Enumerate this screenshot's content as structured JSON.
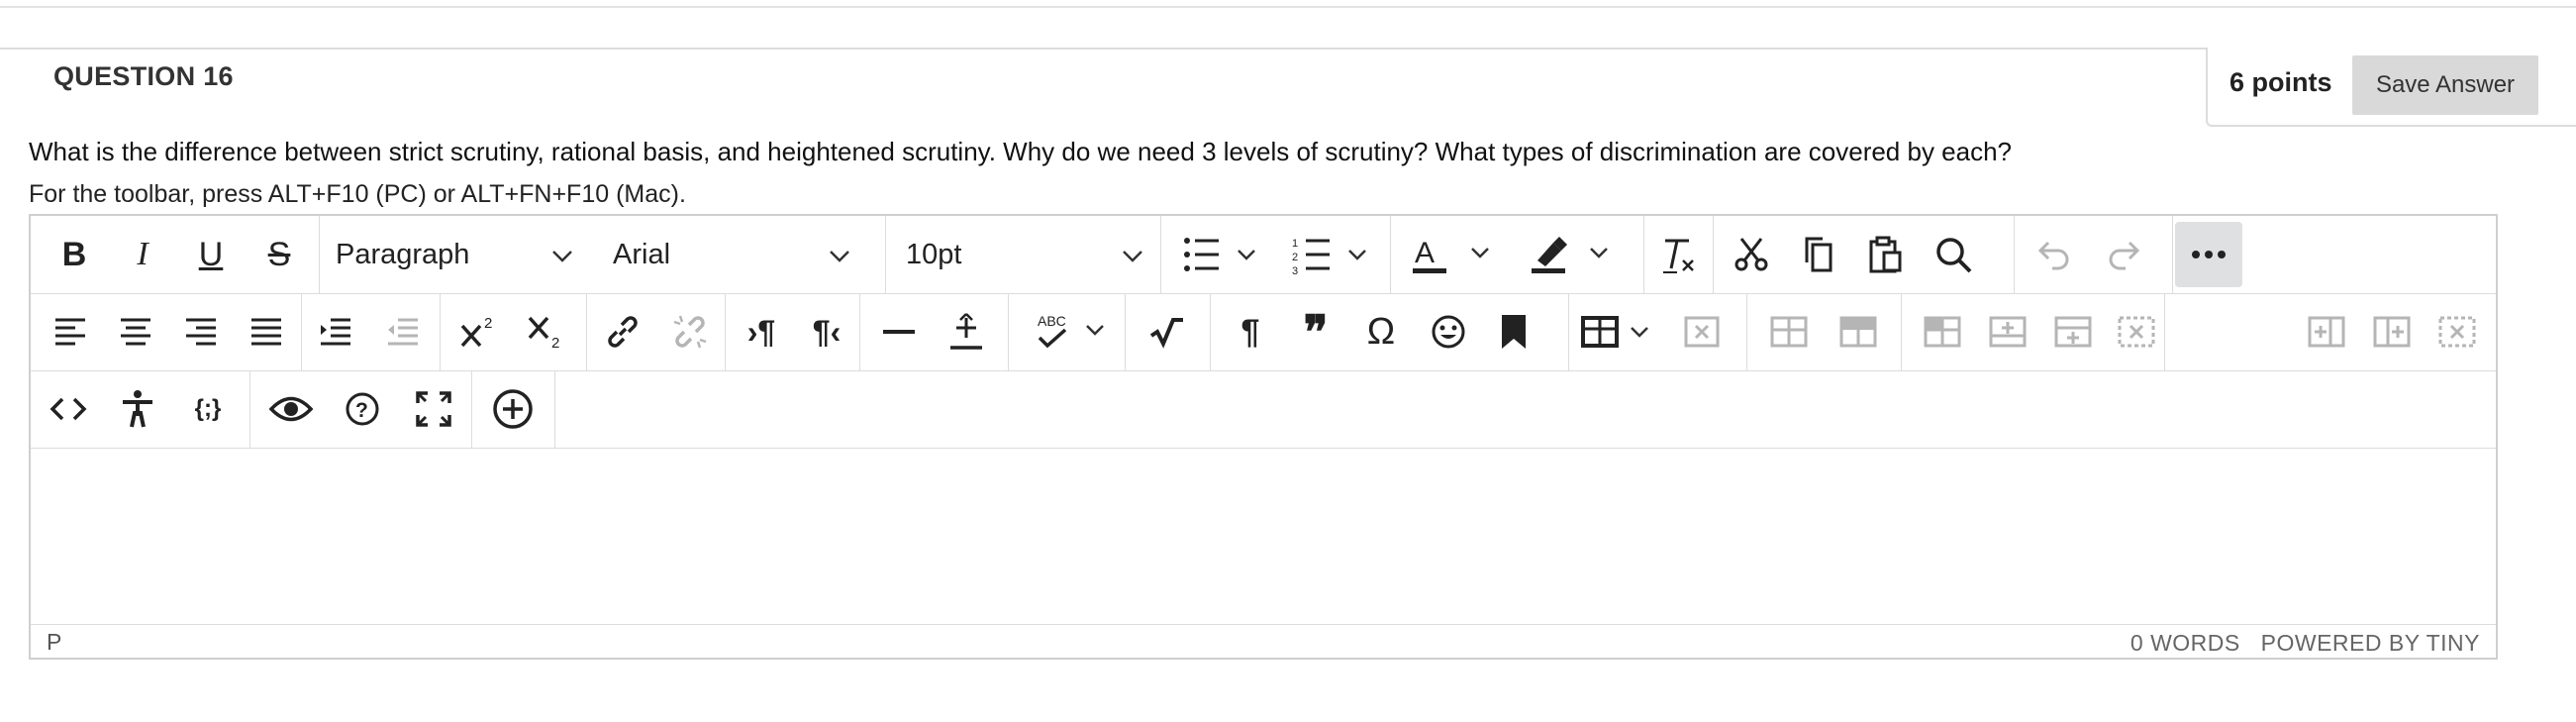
{
  "question": {
    "title": "QUESTION 16",
    "points": "6 points",
    "save_label": "Save Answer",
    "text": "What is the difference between strict scrutiny, rational basis, and heightened scrutiny. Why do we need 3 levels of scrutiny? What types of discrimination are covered by each?"
  },
  "editor": {
    "toolbar_hint": "For the toolbar, press ALT+F10 (PC) or ALT+FN+F10 (Mac).",
    "block_format": "Paragraph",
    "font_family": "Arial",
    "font_size": "10pt",
    "status_path": "P",
    "word_count": "0 WORDS",
    "powered_by": "POWERED BY TINY"
  },
  "icons": [
    "bold-icon",
    "italic-icon",
    "underline-icon",
    "strikethrough-icon",
    "bullet-list-icon",
    "numbered-list-icon",
    "text-color-icon",
    "highlight-icon",
    "clear-formatting-icon",
    "cut-icon",
    "copy-icon",
    "paste-icon",
    "search-icon",
    "undo-icon",
    "redo-icon",
    "more-icon",
    "align-left-icon",
    "align-center-icon",
    "align-right-icon",
    "justify-icon",
    "indent-icon",
    "outdent-icon",
    "superscript-icon",
    "subscript-icon",
    "link-icon",
    "unlink-icon",
    "ltr-icon",
    "rtl-icon",
    "horizontal-line-icon",
    "plus-minus-icon",
    "spellcheck-icon",
    "math-icon",
    "paragraph-mark-icon",
    "blockquote-icon",
    "omega-icon",
    "emoji-icon",
    "bookmark-icon",
    "table-icon",
    "code-icon",
    "accessibility-icon",
    "variable-icon",
    "preview-icon",
    "help-icon",
    "fullscreen-icon",
    "add-content-icon"
  ]
}
